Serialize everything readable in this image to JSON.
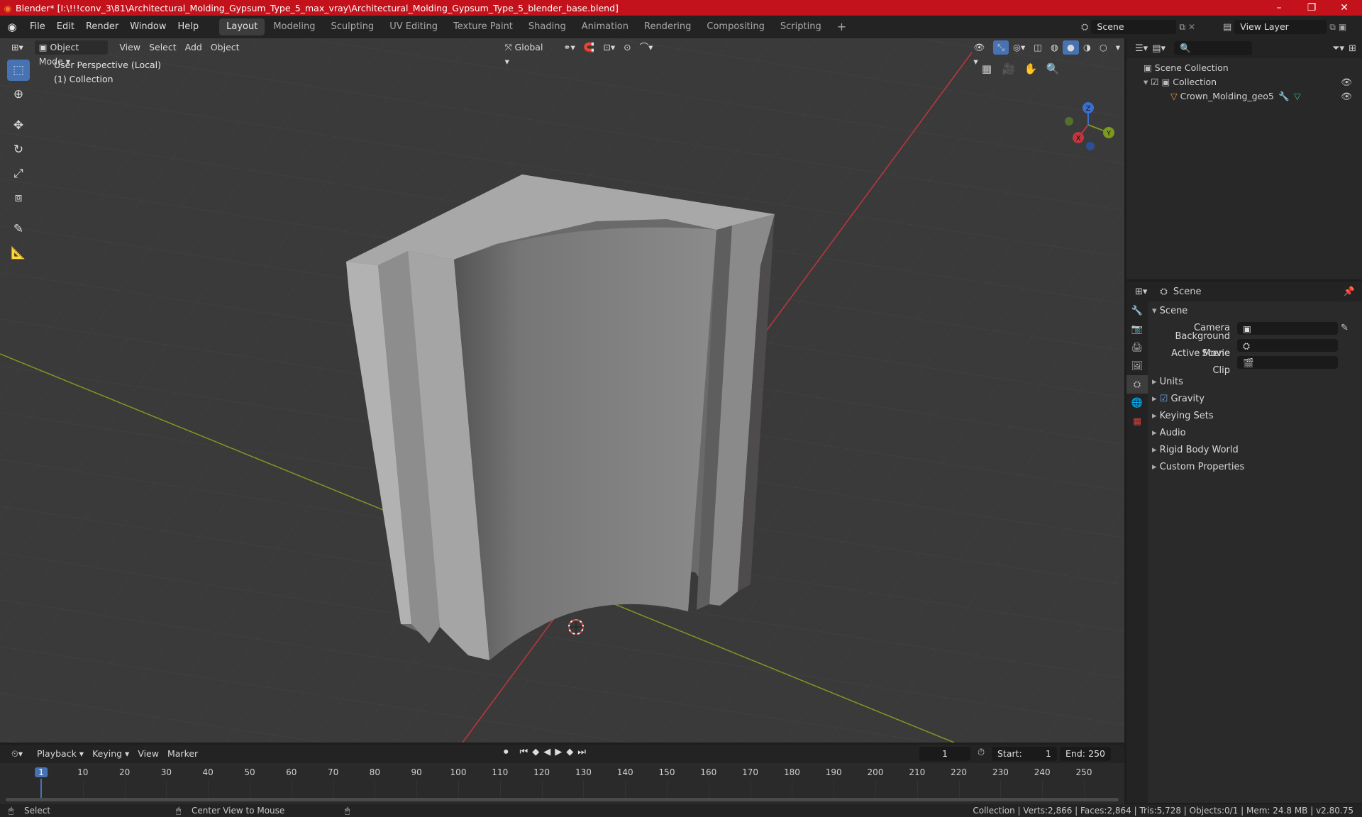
{
  "window": {
    "title": "Blender* [I:\\!!!conv_3\\81\\Architectural_Molding_Gypsum_Type_5_max_vray\\Architectural_Molding_Gypsum_Type_5_blender_base.blend]",
    "minimize": "–",
    "maximize": "❐",
    "close": "✕"
  },
  "menubar": {
    "items": [
      "File",
      "Edit",
      "Render",
      "Window",
      "Help"
    ],
    "workspaces": [
      "Layout",
      "Modeling",
      "Sculpting",
      "UV Editing",
      "Texture Paint",
      "Shading",
      "Animation",
      "Rendering",
      "Compositing",
      "Scripting"
    ],
    "active_workspace": "Layout",
    "add_workspace": "+",
    "scene_label": "Scene",
    "view_layer_label": "View Layer"
  },
  "viewport": {
    "mode": "Object Mode",
    "menus": [
      "View",
      "Select",
      "Add",
      "Object"
    ],
    "orientation": "Global",
    "perspective_label": "User Perspective (Local)",
    "collection_label": "(1) Collection",
    "gizmo": {
      "x": "X",
      "y": "Y",
      "z": "Z"
    }
  },
  "outliner": {
    "search_placeholder": "",
    "root": "Scene Collection",
    "collection": "Collection",
    "object": "Crown_Molding_geo5"
  },
  "properties": {
    "header": "Scene",
    "panel_title": "Scene",
    "camera_label": "Camera",
    "background_scene_label": "Background Scene",
    "active_clip_label": "Active Movie Clip",
    "sections": [
      "Units",
      "Gravity",
      "Keying Sets",
      "Audio",
      "Rigid Body World",
      "Custom Properties"
    ],
    "gravity_checked": true
  },
  "timeline": {
    "menus": [
      "Playback",
      "Keying",
      "View",
      "Marker"
    ],
    "current_frame": "1",
    "start_label": "Start:",
    "start_value": "1",
    "end_label": "End:",
    "end_value": "250",
    "ticks": [
      "1",
      "10",
      "20",
      "30",
      "40",
      "50",
      "60",
      "70",
      "80",
      "90",
      "100",
      "110",
      "120",
      "130",
      "140",
      "150",
      "160",
      "170",
      "180",
      "190",
      "200",
      "210",
      "220",
      "230",
      "240",
      "250"
    ]
  },
  "statusbar": {
    "select": "Select",
    "center_view": "Center View to Mouse",
    "stats": "Collection | Verts:2,866 | Faces:2,864 | Tris:5,728 | Objects:0/1 | Mem: 24.8 MB | v2.80.75"
  },
  "colors": {
    "titlebar": "#c3121b",
    "active_tool": "#4772b3",
    "x_axis": "#c0363f",
    "y_axis": "#7c9a1f",
    "z_axis": "#3a6fd0"
  }
}
